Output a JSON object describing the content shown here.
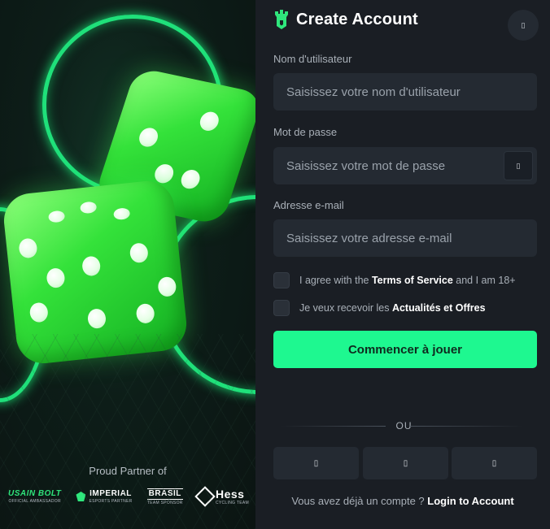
{
  "promo": {
    "partner_label": "Proud Partner of",
    "partners": [
      {
        "name": "USAIN BOLT",
        "sub": "OFFICIAL AMBASSADOR"
      },
      {
        "name": "IMPERIAL",
        "sub": "ESPORTS PARTNER"
      },
      {
        "name": "BRASIL",
        "sub": "TEAM SPONSOR"
      },
      {
        "name": "Hess",
        "sub": "CYCLING TEAM"
      }
    ]
  },
  "header": {
    "title": "Create Account",
    "logo_icon": "castle-icon",
    "close_icon": "close-icon",
    "close_glyph": "▯"
  },
  "form": {
    "username": {
      "label": "Nom d'utilisateur",
      "placeholder": "Saisissez votre nom d'utilisateur"
    },
    "password": {
      "label": "Mot de passe",
      "placeholder": "Saisissez votre mot de passe",
      "toggle_glyph": "▯"
    },
    "email": {
      "label": "Adresse e-mail",
      "placeholder": "Saisissez votre adresse e-mail"
    },
    "terms": {
      "prefix": "I agree with the ",
      "link": "Terms of Service",
      "suffix": " and I am 18+"
    },
    "news": {
      "prefix": "Je veux recevoir les ",
      "link": "Actualités et Offres"
    },
    "submit_label": "Commencer à jouer",
    "divider_label": "OU",
    "social_glyphs": [
      "▯",
      "▯",
      "▯"
    ],
    "login_prompt": "Vous avez déjà un compte ? ",
    "login_link": "Login to Account"
  },
  "colors": {
    "accent": "#1ef890",
    "panel_bg": "#1a1e24",
    "input_bg": "#242a32",
    "ring_green": "#1fe07a"
  }
}
